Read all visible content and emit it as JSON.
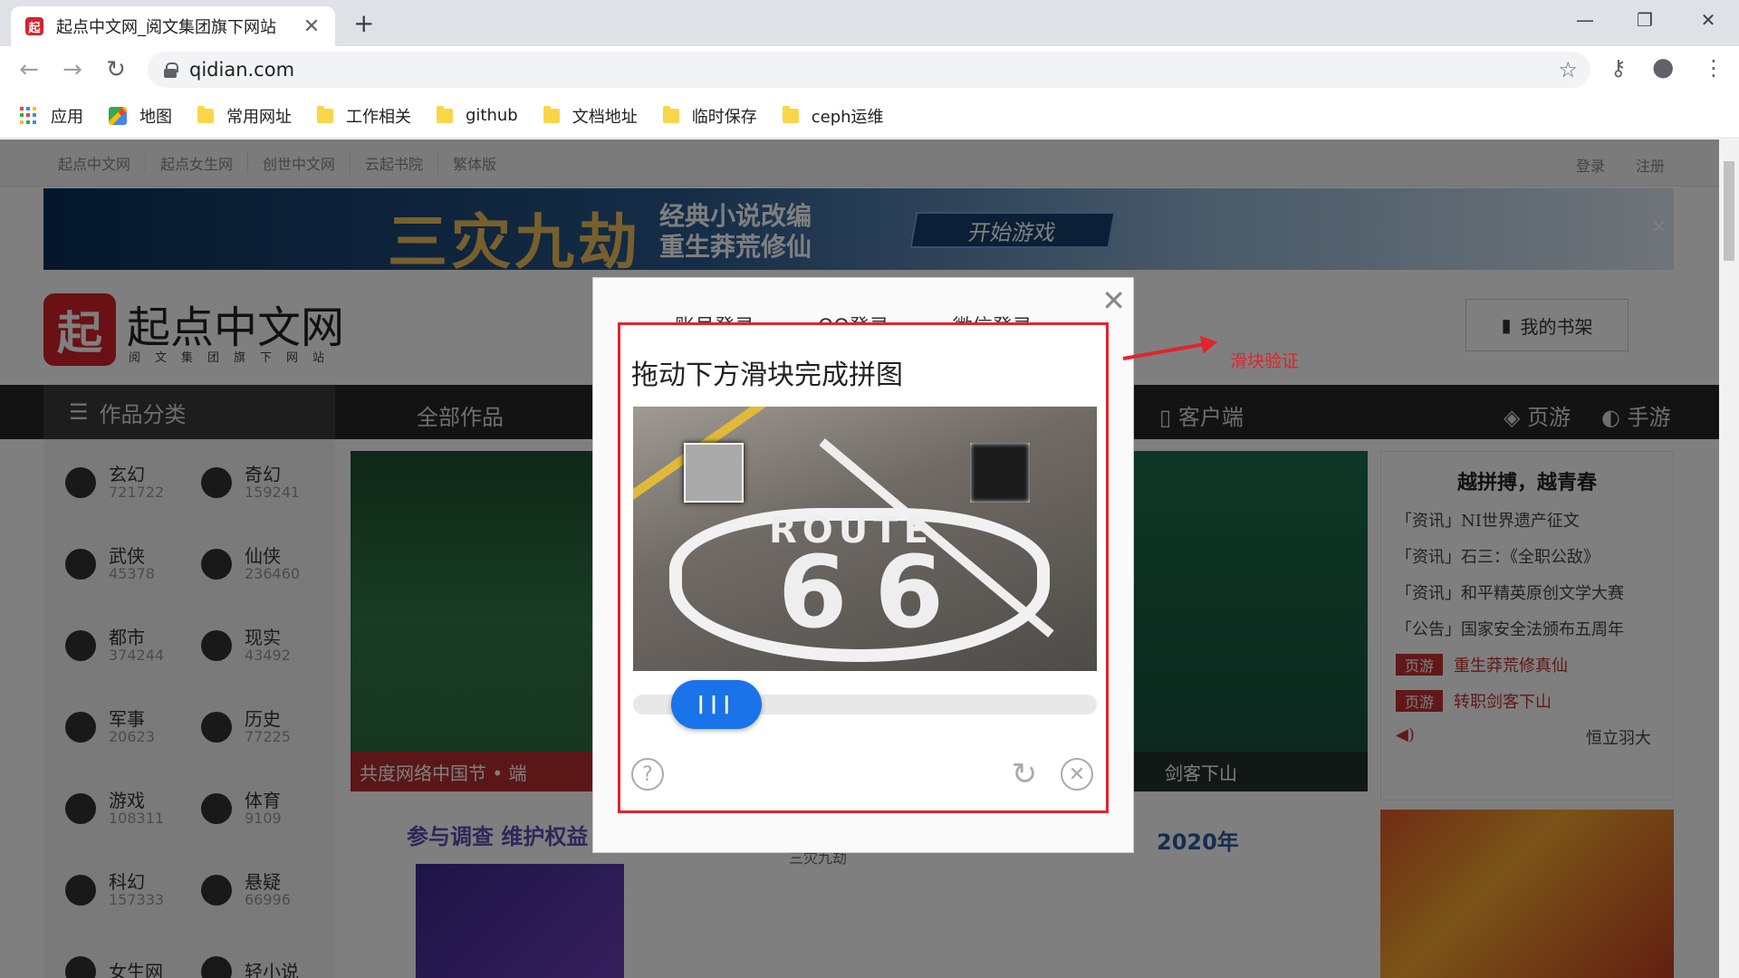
{
  "browser": {
    "tab_title": "起点中文网_阅文集团旗下网站",
    "tab_favicon": "起",
    "url": "qidian.com",
    "bookmarks": [
      {
        "label": "应用",
        "icon": "apps-grid-icon"
      },
      {
        "label": "地图",
        "icon": "maps-icon"
      },
      {
        "label": "常用网址",
        "icon": "folder-icon"
      },
      {
        "label": "工作相关",
        "icon": "folder-icon"
      },
      {
        "label": "github",
        "icon": "folder-icon"
      },
      {
        "label": "文档地址",
        "icon": "folder-icon"
      },
      {
        "label": "临时保存",
        "icon": "folder-icon"
      },
      {
        "label": "ceph运维",
        "icon": "folder-icon"
      }
    ]
  },
  "site": {
    "topnav": [
      "起点中文网",
      "起点女生网",
      "创世中文网",
      "云起书院",
      "繁体版"
    ],
    "login": "登录",
    "register": "注册",
    "banner": {
      "title": "三灾九劫",
      "line1": "经典小说改编",
      "line2": "重生莽荒修仙",
      "button": "开始游戏"
    },
    "logo_char": "起",
    "logo_text": "起点中文网",
    "logo_sub": "阅文集团旗下网站",
    "shelf": "我的书架",
    "mainnav": {
      "category": "作品分类",
      "all": "全部作品",
      "client": "客户端",
      "pageyou": "页游",
      "shouyou": "手游"
    },
    "categories": [
      {
        "name": "玄幻",
        "count": "721722"
      },
      {
        "name": "奇幻",
        "count": "159241"
      },
      {
        "name": "武侠",
        "count": "45378"
      },
      {
        "name": "仙侠",
        "count": "236460"
      },
      {
        "name": "都市",
        "count": "374244"
      },
      {
        "name": "现实",
        "count": "43492"
      },
      {
        "name": "军事",
        "count": "20623"
      },
      {
        "name": "历史",
        "count": "77225"
      },
      {
        "name": "游戏",
        "count": "108311"
      },
      {
        "name": "体育",
        "count": "9109"
      },
      {
        "name": "科幻",
        "count": "157333"
      },
      {
        "name": "悬疑",
        "count": "66996"
      },
      {
        "name": "女生网",
        "count": ""
      },
      {
        "name": "轻小说",
        "count": ""
      }
    ],
    "promo1_caption": "共度网络中国节 • 端",
    "promo2_caption": "剑客下山",
    "news": {
      "title": "越拼搏，越青春",
      "items": [
        "「资讯」NI世界遗产征文",
        "「资讯」石三：《全职公敌》",
        "「资讯」和平精英原创文学大赛",
        "「公告」国家安全法颁布五周年"
      ],
      "game_items": [
        {
          "tag": "页游",
          "text": "重生莽荒修真仙"
        },
        {
          "tag": "页游",
          "text": "转职剑客下山"
        }
      ],
      "author": "恒立羽大"
    },
    "bottom": {
      "survey": "参与调查  维护权益",
      "year": "2020年",
      "sub": "三灾九劫"
    }
  },
  "login_panel": {
    "tabs": [
      "账号登录",
      "QQ登录",
      "微信登录"
    ]
  },
  "captcha": {
    "title": "拖动下方滑块完成拼图",
    "knob": "III"
  },
  "annotation": {
    "label": "滑块验证"
  }
}
